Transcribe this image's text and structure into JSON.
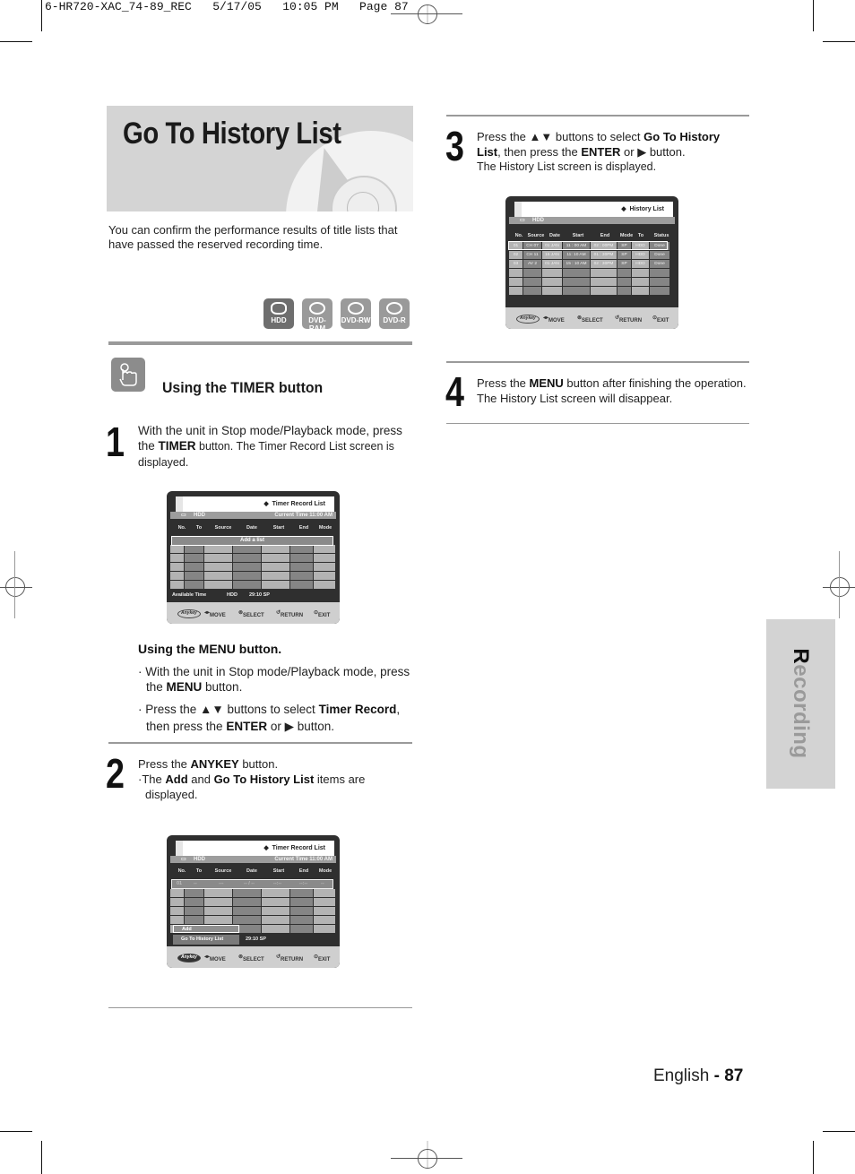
{
  "slug": "6-HR720-XAC_74-89_REC   5/17/05   10:05 PM   Page 87",
  "title": "Go To History List",
  "intro": "You can confirm the performance results of title lists that have passed the reserved recording time.",
  "media_icons": [
    {
      "icon": "hdd-icon",
      "label": "HDD"
    },
    {
      "icon": "dvd-ram-icon",
      "label": "DVD-RAM"
    },
    {
      "icon": "dvd-rw-icon",
      "label": "DVD-RW"
    },
    {
      "icon": "dvd-r-icon",
      "label": "DVD-R"
    }
  ],
  "timer_section": {
    "heading": "Using the TIMER button",
    "icon": "hand-press-icon"
  },
  "steps": {
    "s1": {
      "num": "1",
      "pre": "With the unit in Stop mode/Playback mode, press the ",
      "b1": "TIMER",
      "post": " button. The Timer Record List screen is displayed."
    },
    "menu": {
      "heading": "Using the MENU button.",
      "bullet1_pre": "With the unit in Stop mode/Playback mode, press the ",
      "bullet1_b": "MENU",
      "bullet1_post": " button.",
      "bullet2_pre": "Press the ▲▼ buttons to select ",
      "bullet2_b1": "Timer Record",
      "bullet2_mid": ", then press the ",
      "bullet2_b2": "ENTER",
      "bullet2_post": " or ▶ button."
    },
    "s2": {
      "num": "2",
      "pre": "Press the ",
      "b1": "ANYKEY",
      "post": " button.",
      "bullet_pre": "The ",
      "bullet_b1": "Add",
      "bullet_mid": " and ",
      "bullet_b2": "Go To History List",
      "bullet_post": " items are displayed."
    },
    "s3": {
      "num": "3",
      "pre": "Press the ▲▼ buttons to select ",
      "b1": "Go To History List",
      "mid": ", then press the ",
      "b2": "ENTER",
      "post": " or ▶ button.",
      "line2": "The History List screen is displayed."
    },
    "s4": {
      "num": "4",
      "pre": "Press the ",
      "b1": "MENU",
      "post": " button after finishing the operation.",
      "line2": "The History List screen will disappear."
    }
  },
  "screen1": {
    "title": "Timer Record List",
    "drive": "HDD",
    "current_time": "Current Time 11:00 AM",
    "columns": [
      "No.",
      "To",
      "Source",
      "Date",
      "Start",
      "End",
      "Mode"
    ],
    "add_row": "Add a list",
    "available_label": "Available Time",
    "available_drive": "HDD",
    "available_value": "29:10  SP",
    "footer": {
      "anykey": "Anykey",
      "move": "MOVE",
      "select": "SELECT",
      "return": "RETURN",
      "exit": "EXIT"
    }
  },
  "screen2": {
    "title": "Timer Record List",
    "drive": "HDD",
    "current_time": "Current Time 11:00 AM",
    "columns": [
      "No.",
      "To",
      "Source",
      "Date",
      "Start",
      "End",
      "Mode"
    ],
    "row1": [
      "01",
      "--",
      "---",
      "-- / --",
      "--:--",
      "--:--",
      "--"
    ],
    "popup": [
      "Add",
      "Go To History List"
    ],
    "available_value": "29:10  SP",
    "footer": {
      "anykey": "Anykey",
      "move": "MOVE",
      "select": "SELECT",
      "return": "RETURN",
      "exit": "EXIT"
    }
  },
  "screen3": {
    "title": "History List",
    "drive": "HDD",
    "columns": [
      "No.",
      "Source",
      "Date",
      "Start",
      "End",
      "Mode",
      "To",
      "Status"
    ],
    "rows": [
      [
        "01",
        "CH 07",
        "01 JAN",
        "11 : 00 AM",
        "02 : 00PM",
        "SP",
        "HDD",
        "Done"
      ],
      [
        "02",
        "CH 11",
        "15 JAN",
        "11: 10 AM",
        "01 : 30PM",
        "SP",
        "HDD",
        "Done"
      ],
      [
        "03",
        "AV 2",
        "01 JAN",
        "15 : 10 AM",
        "02 : 30PM",
        "SP",
        "HDD",
        "Done"
      ]
    ],
    "footer": {
      "anykey": "Anykey",
      "move": "MOVE",
      "select": "SELECT",
      "return": "RETURN",
      "exit": "EXIT"
    }
  },
  "side_tab": {
    "first": "R",
    "rest": "ecording"
  },
  "page_number": {
    "lang": "English",
    "sep": " - ",
    "num": "87"
  }
}
